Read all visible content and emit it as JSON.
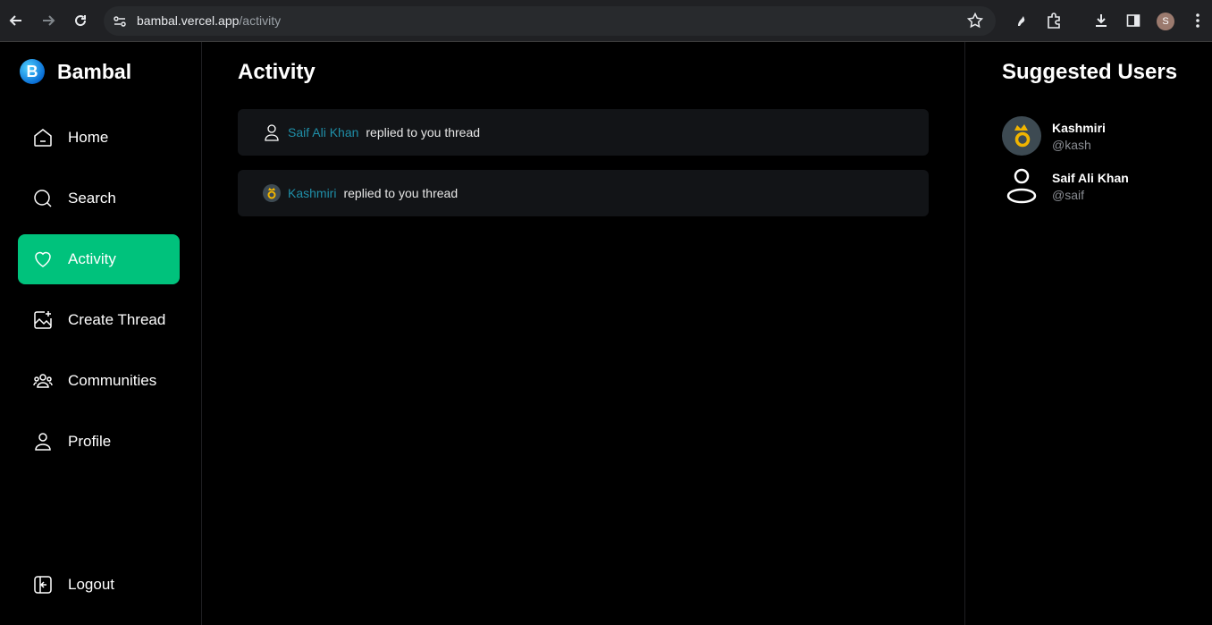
{
  "browser": {
    "url_host": "bambal.vercel.app",
    "url_path": "/activity",
    "profile_initial": "S"
  },
  "sidebar": {
    "brand": "Bambal",
    "logo_letter": "B",
    "items": [
      {
        "label": "Home",
        "icon": "home-icon",
        "active": false
      },
      {
        "label": "Search",
        "icon": "search-icon",
        "active": false
      },
      {
        "label": "Activity",
        "icon": "heart-icon",
        "active": true
      },
      {
        "label": "Create Thread",
        "icon": "create-thread-icon",
        "active": false
      },
      {
        "label": "Communities",
        "icon": "communities-icon",
        "active": false
      },
      {
        "label": "Profile",
        "icon": "profile-icon",
        "active": false
      }
    ],
    "logout": "Logout"
  },
  "main": {
    "title": "Activity",
    "activities": [
      {
        "user": "Saif Ali Khan",
        "text": "replied to you thread",
        "avatar": "default-user-icon"
      },
      {
        "user": "Kashmiri",
        "text": "replied to you thread",
        "avatar": "kashmiri-avatar"
      }
    ]
  },
  "suggested": {
    "title": "Suggested Users",
    "users": [
      {
        "name": "Kashmiri",
        "handle": "@kash",
        "avatar": "kashmiri-avatar"
      },
      {
        "name": "Saif Ali Khan",
        "handle": "@saif",
        "avatar": "default-user-icon"
      }
    ]
  },
  "colors": {
    "accent": "#00c27c",
    "link": "#1f8fa8",
    "card": "#121417",
    "background": "#000000"
  }
}
